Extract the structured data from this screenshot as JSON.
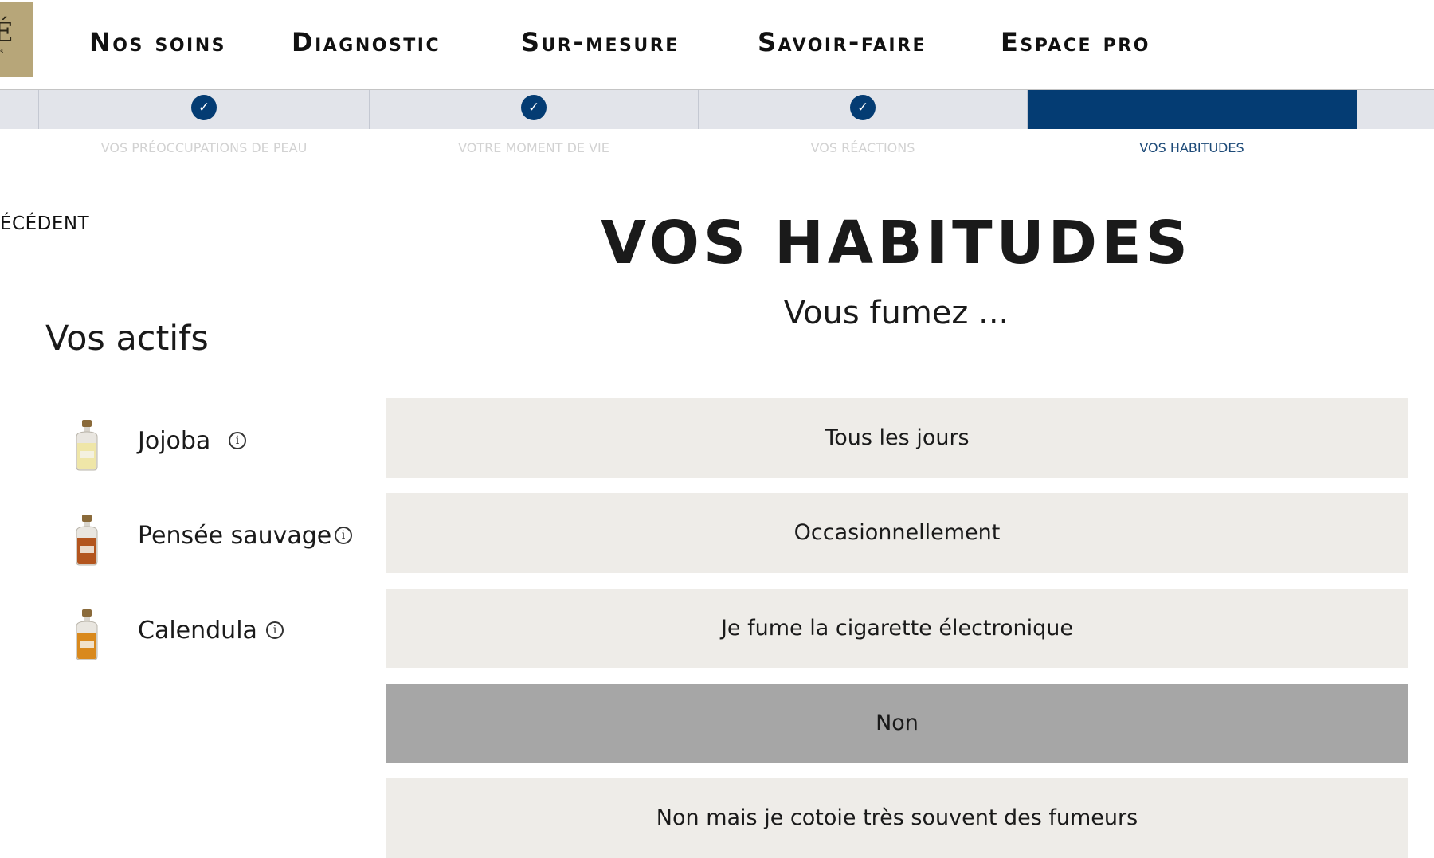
{
  "header": {
    "nav": [
      "Nos soins",
      "Diagnostic",
      "Sur-mesure",
      "Savoir-faire",
      "Espace pro"
    ]
  },
  "stepper": {
    "steps": [
      {
        "label": "Vos préoccupations de peau",
        "state": "completed"
      },
      {
        "label": "Votre moment de vie",
        "state": "completed"
      },
      {
        "label": "Vos réactions",
        "state": "completed"
      },
      {
        "label": "Vos habitudes",
        "state": "current"
      }
    ]
  },
  "back_link": "ÉCÉDENT",
  "main": {
    "title": "VOS HABITUDES",
    "question": "Vous fumez ...",
    "options": [
      {
        "label": "Tous les jours",
        "selected": false
      },
      {
        "label": "Occasionnellement",
        "selected": false
      },
      {
        "label": "Je fume la cigarette électronique",
        "selected": false
      },
      {
        "label": "Non",
        "selected": true
      },
      {
        "label": "Non mais je cotoie très souvent des fumeurs",
        "selected": false
      }
    ]
  },
  "sidebar": {
    "title": "Vos actifs",
    "actifs": [
      {
        "name": "Jojoba",
        "icon": "bottle-icon",
        "liquid_color": "#efe6a8"
      },
      {
        "name": "Pensée sauvage",
        "icon": "bottle-icon",
        "liquid_color": "#b3551e"
      },
      {
        "name": "Calendula",
        "icon": "bottle-icon",
        "liquid_color": "#d9891d"
      }
    ]
  },
  "colors": {
    "accent": "#043c73",
    "option_bg": "#eeece8",
    "option_selected_bg": "#a6a6a6",
    "logo_bg": "#b7a679"
  }
}
